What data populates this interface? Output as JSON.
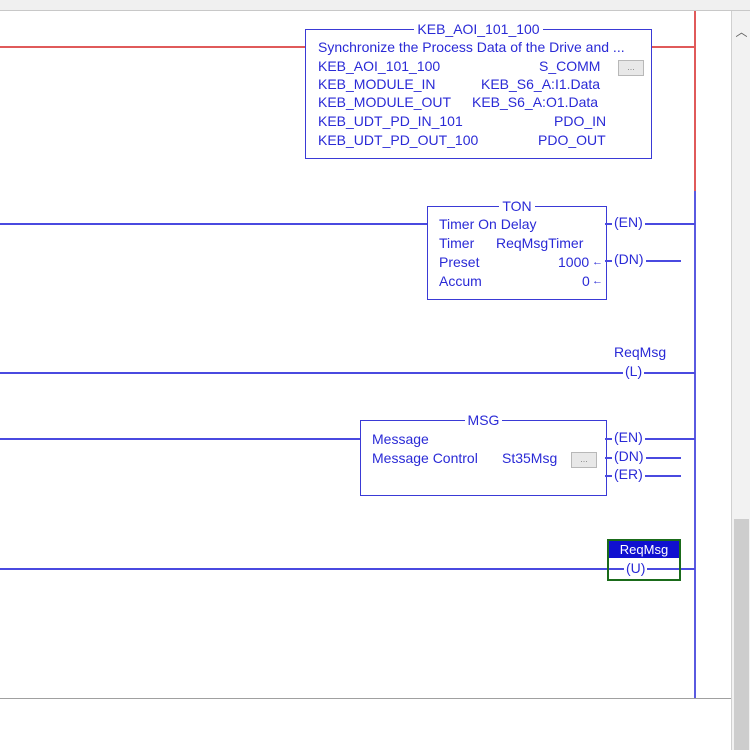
{
  "rung1": {
    "aoi": {
      "title": "KEB_AOI_101_100",
      "description": "Synchronize the Process Data of the Drive and ...",
      "params": [
        {
          "name": "KEB_AOI_101_100",
          "value": "S_COMM"
        },
        {
          "name": "KEB_MODULE_IN",
          "value": "KEB_S6_A:I1.Data"
        },
        {
          "name": "KEB_MODULE_OUT",
          "value": "KEB_S6_A:O1.Data"
        },
        {
          "name": "KEB_UDT_PD_IN_101",
          "value": "PDO_IN"
        },
        {
          "name": "KEB_UDT_PD_OUT_100",
          "value": "PDO_OUT"
        }
      ]
    }
  },
  "rung2": {
    "ton": {
      "title": "TON",
      "name": "Timer On Delay",
      "timer_label": "Timer",
      "timer_value": "ReqMsgTimer",
      "preset_label": "Preset",
      "preset_value": "1000",
      "accum_label": "Accum",
      "accum_value": "0",
      "en": "EN",
      "dn": "DN"
    }
  },
  "rung3": {
    "coil": {
      "tag": "ReqMsg",
      "type": "L"
    }
  },
  "rung4": {
    "msg": {
      "title": "MSG",
      "name": "Message",
      "control_label": "Message Control",
      "control_value": "St35Msg",
      "en": "EN",
      "dn": "DN",
      "er": "ER"
    }
  },
  "rung5": {
    "coil": {
      "tag": "ReqMsg",
      "type": "U"
    }
  }
}
